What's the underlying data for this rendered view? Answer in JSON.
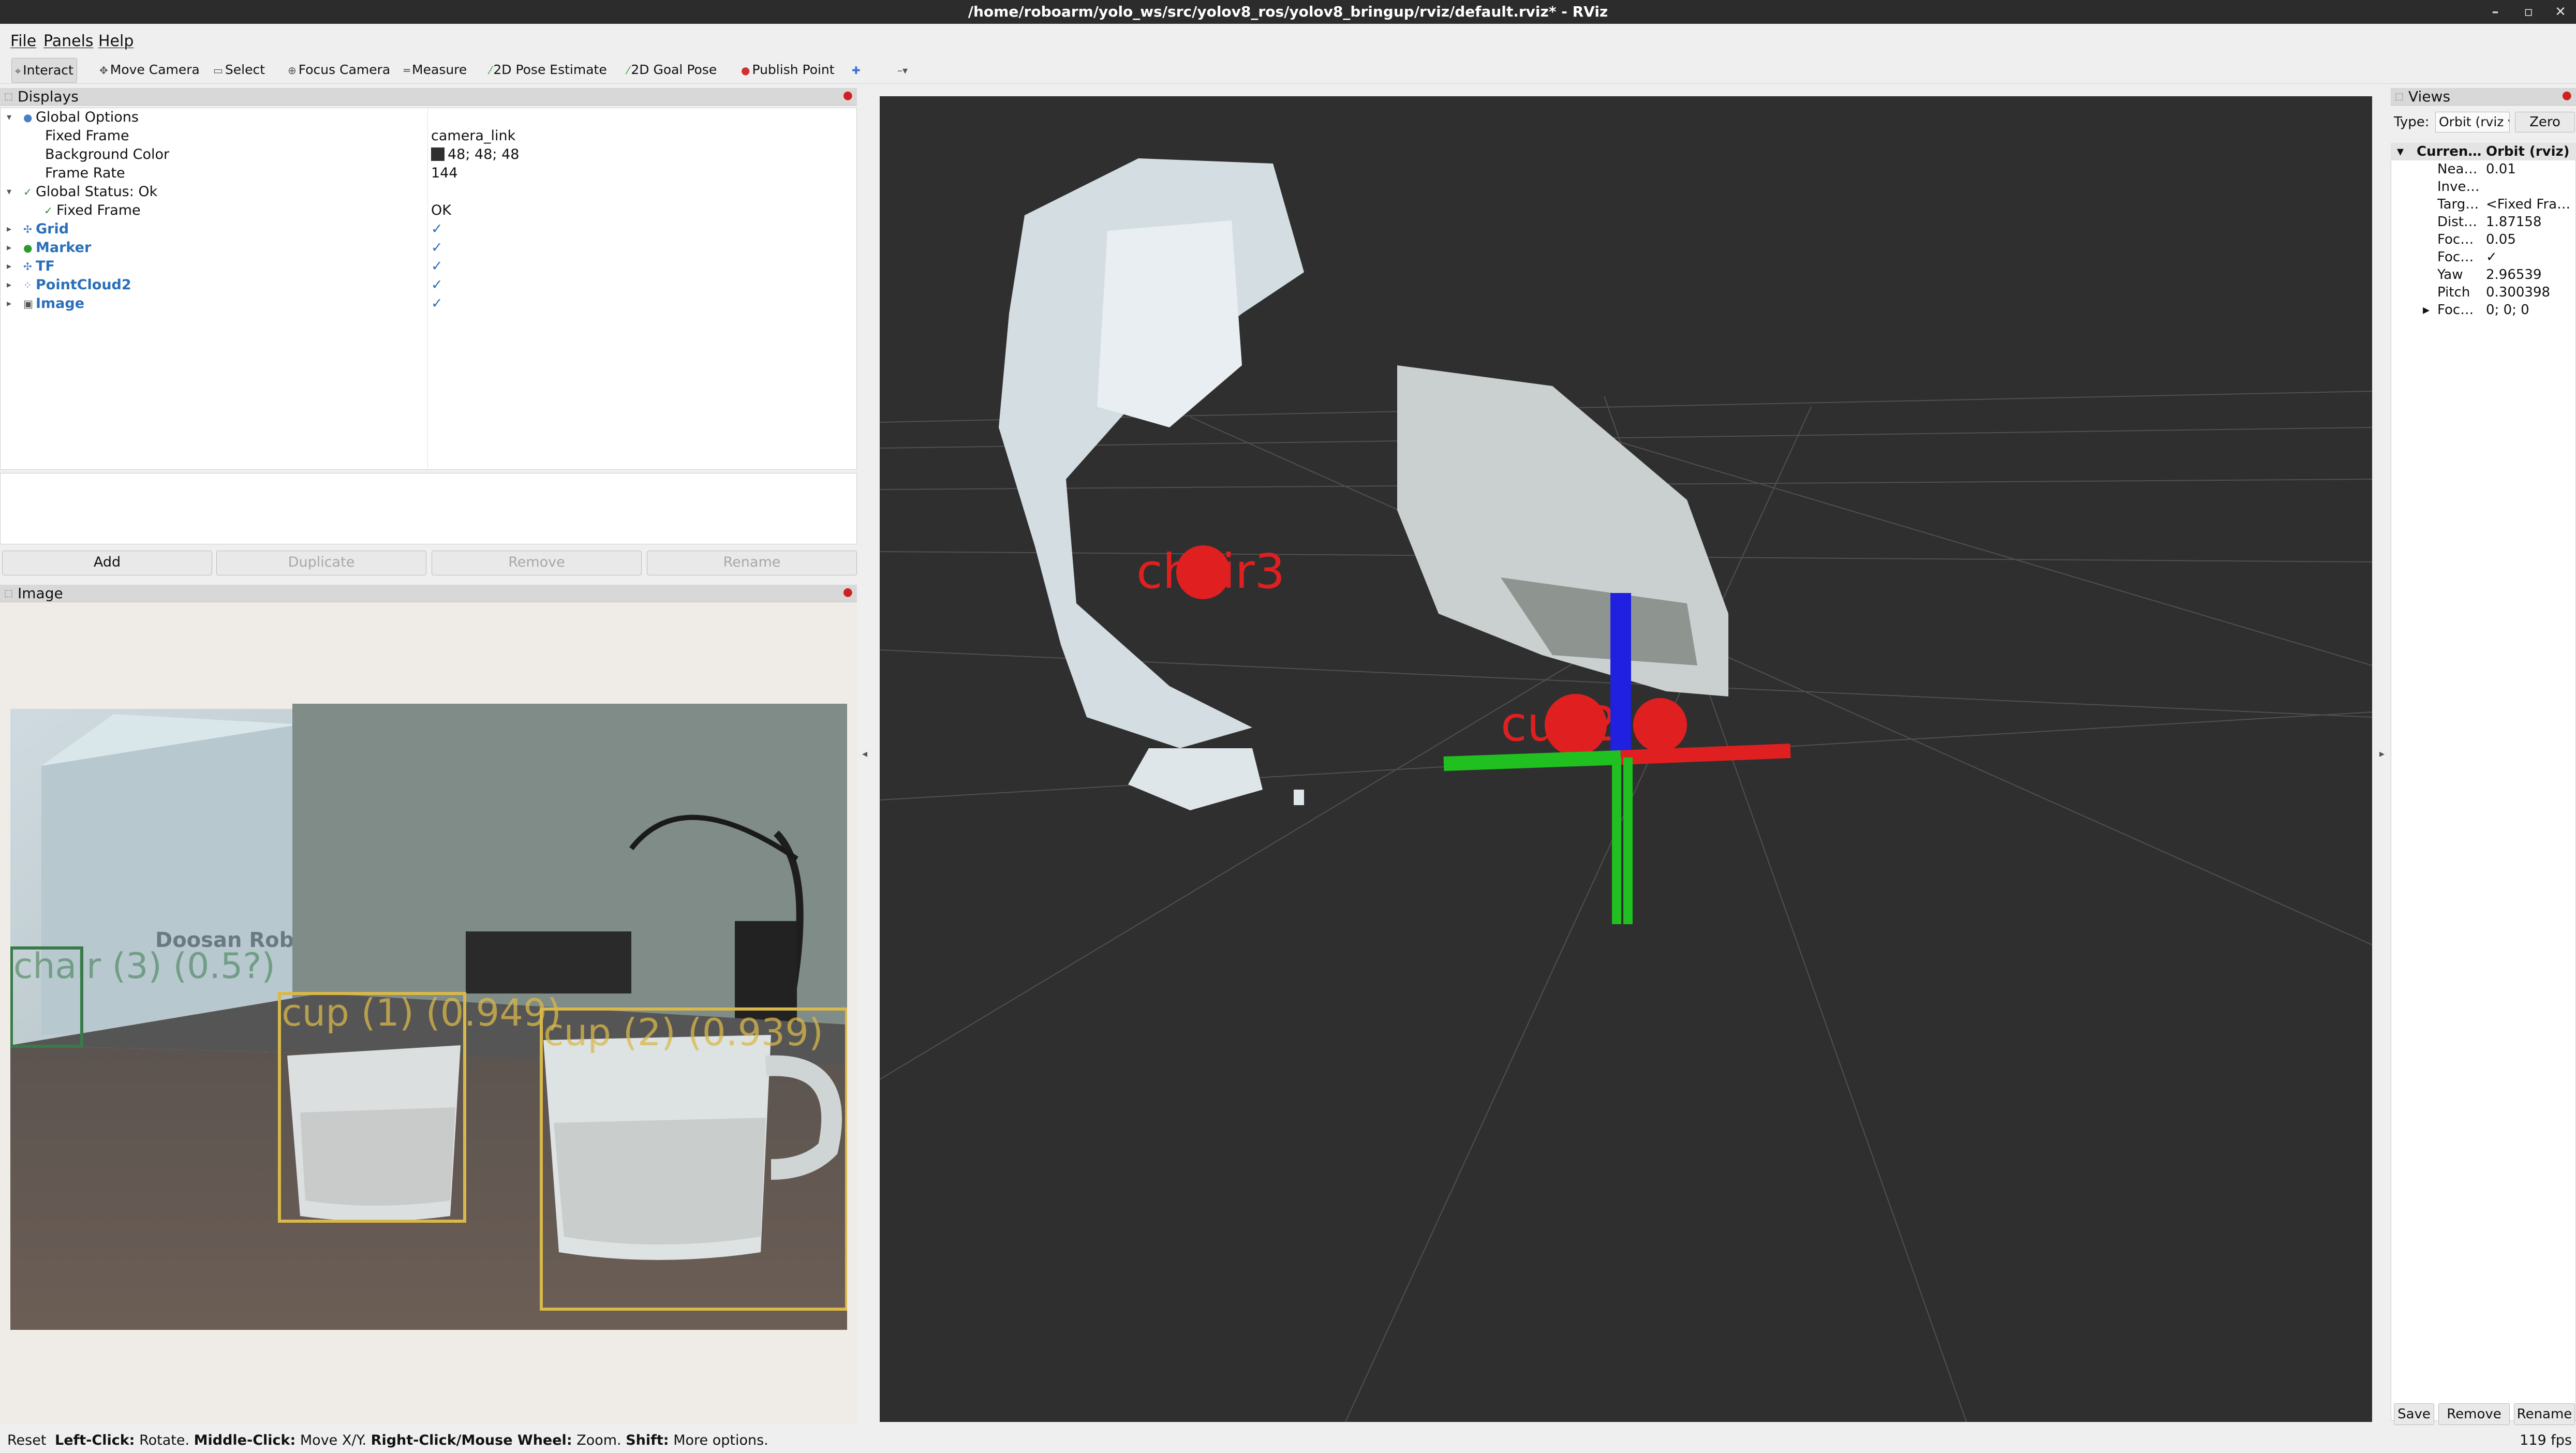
{
  "window": {
    "title": "/home/roboarm/yolo_ws/src/yolov8_ros/yolov8_bringup/rviz/default.rviz* - RViz",
    "controls": [
      "–",
      "▫",
      "✕"
    ]
  },
  "menu": [
    "File",
    "Panels",
    "Help"
  ],
  "toolbar": {
    "interact": "Interact",
    "move_camera": "Move Camera",
    "select": "Select",
    "focus_camera": "Focus Camera",
    "measure": "Measure",
    "pose_estimate": "2D Pose Estimate",
    "goal_pose": "2D Goal Pose",
    "publish_point": "Publish Point"
  },
  "displays": {
    "title": "Displays",
    "global_options": "Global Options",
    "fixed_frame_label": "Fixed Frame",
    "fixed_frame_value": "camera_link",
    "bg_color_label": "Background Color",
    "bg_color_value": "48; 48; 48",
    "bg_color_hex": "#303030",
    "frame_rate_label": "Frame Rate",
    "frame_rate_value": "144",
    "global_status": "Global Status: Ok",
    "status_fixed_frame": "Fixed Frame",
    "status_value": "OK",
    "items": [
      {
        "name": "Grid",
        "checked": "✓"
      },
      {
        "name": "Marker",
        "checked": "✓"
      },
      {
        "name": "TF",
        "checked": "✓"
      },
      {
        "name": "PointCloud2",
        "checked": "✓"
      },
      {
        "name": "Image",
        "checked": "✓"
      }
    ],
    "buttons": {
      "add": "Add",
      "duplicate": "Duplicate",
      "remove": "Remove",
      "rename": "Rename"
    }
  },
  "image_panel": {
    "title": "Image",
    "detections": [
      {
        "label": "chair (3) (0.5?)",
        "color": "#3a7a4a"
      },
      {
        "label": "cup (1) (0.949)",
        "color": "#d8b84a"
      },
      {
        "label": "cup (2) (0.939)",
        "color": "#d8b84a"
      }
    ],
    "box_text": "Doosan Robotics"
  },
  "viewport": {
    "markers": [
      {
        "label": "chair3",
        "color": "#e02020"
      },
      {
        "label": "cup2",
        "color": "#e02020"
      },
      {
        "label": "cup1",
        "color": "#e02020"
      }
    ],
    "axes_colors": {
      "x": "#e02020",
      "y": "#20c020",
      "z": "#2020e0"
    }
  },
  "views": {
    "title": "Views",
    "type_label": "Type:",
    "type_value": "Orbit (rviz",
    "zero_button": "Zero",
    "current_label": "Curren…",
    "current_value": "Orbit (rviz)",
    "props": [
      {
        "name": "Nea…",
        "value": "0.01"
      },
      {
        "name": "Inve…",
        "value": ""
      },
      {
        "name": "Targ…",
        "value": "<Fixed Fra…"
      },
      {
        "name": "Dist…",
        "value": "1.87158"
      },
      {
        "name": "Foc…",
        "value": "0.05"
      },
      {
        "name": "Foc…",
        "value": "✓"
      },
      {
        "name": "Yaw",
        "value": "2.96539"
      },
      {
        "name": "Pitch",
        "value": "0.300398"
      },
      {
        "name": "Foc…",
        "value": "0; 0; 0"
      }
    ],
    "buttons": {
      "save": "Save",
      "remove": "Remove",
      "rename": "Rename"
    }
  },
  "status": {
    "reset": "Reset",
    "left_click": "Left-Click:",
    "left_click_action": "Rotate.",
    "middle_click": "Middle-Click:",
    "middle_click_action": "Move X/Y.",
    "right_click": "Right-Click/Mouse Wheel:",
    "right_click_action": "Zoom.",
    "shift": "Shift:",
    "shift_action": "More options.",
    "fps": "119 fps"
  }
}
